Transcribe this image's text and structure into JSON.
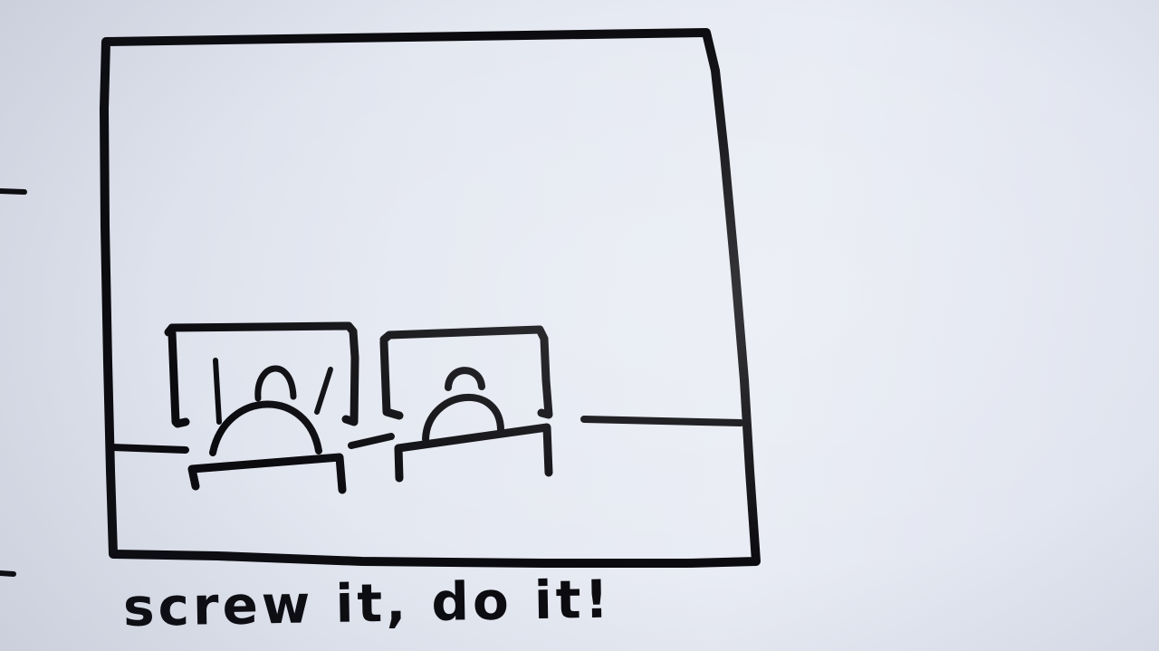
{
  "drawing": {
    "caption": "screw it, do it!",
    "ink_color": "#0b0b0f",
    "paper_color": "#e4e8f1"
  }
}
